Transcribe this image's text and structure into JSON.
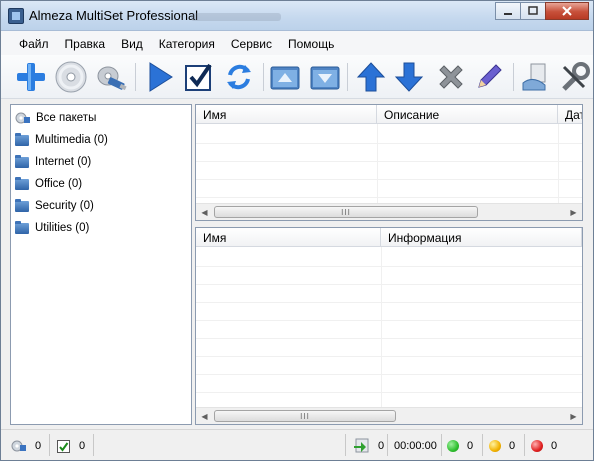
{
  "window": {
    "title": "Almeza MultiSet Professional"
  },
  "menu": [
    "Файл",
    "Правка",
    "Вид",
    "Категория",
    "Сервис",
    "Помощь"
  ],
  "toolbar": {
    "buttons": [
      "add-icon",
      "cd-icon",
      "usb-install-icon",
      "play-icon",
      "checkbox-icon",
      "refresh-icon",
      "folder-up-icon",
      "folder-down-icon",
      "arrow-up-icon",
      "arrow-down-icon",
      "delete-icon",
      "edit-icon",
      "install-icon",
      "tools-icon"
    ]
  },
  "tree": {
    "items": [
      "Все пакеты",
      "Multimedia (0)",
      "Internet (0)",
      "Office (0)",
      "Security (0)",
      "Utilities (0)"
    ]
  },
  "packages_table": {
    "columns": [
      "Имя",
      "Описание",
      "Дат"
    ]
  },
  "details_table": {
    "columns": [
      "Имя",
      "Информация"
    ]
  },
  "scrollbar": {
    "grip": "III"
  },
  "status": {
    "packages_count": "0",
    "checked_count": "0",
    "queue_count": "0",
    "elapsed": "00:00:00",
    "success_count": "0",
    "warning_count": "0",
    "error_count": "0",
    "colors": {
      "success": "#2fbf2f",
      "warning": "#f2b200",
      "error": "#e02020"
    }
  }
}
